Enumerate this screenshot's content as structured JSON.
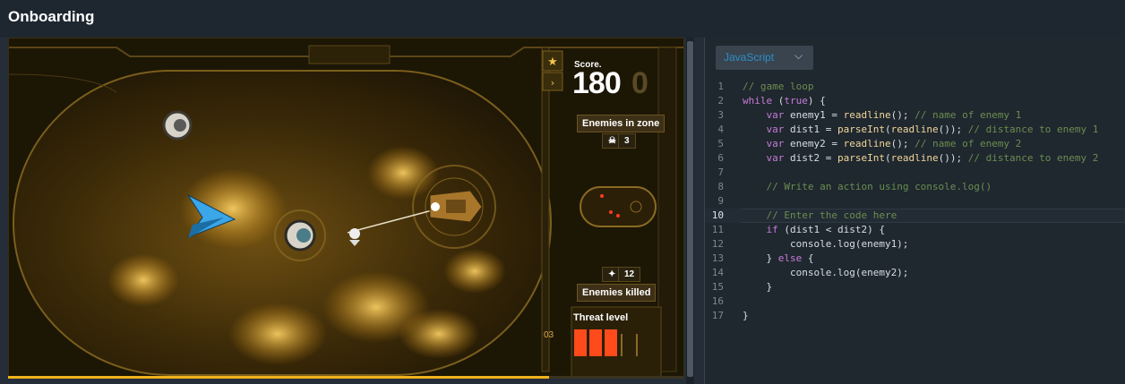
{
  "app": {
    "title": "Onboarding"
  },
  "game": {
    "score_label": "Score.",
    "score_value": "180",
    "score_ghost_digit": "0",
    "enemies_in_zone_label": "Enemies in zone",
    "enemies_in_zone_count": "3",
    "enemies_killed_label": "Enemies killed",
    "enemies_killed_count": "12",
    "threat_level_label": "Threat level",
    "threat_level_value": "03",
    "progress_fraction": 0.8,
    "accent_color": "#f2b21c",
    "icons": [
      "star-icon",
      "arrow-icon",
      "skull-icon",
      "kills-icon",
      "radar-icon"
    ]
  },
  "editor": {
    "language": "JavaScript",
    "active_line": 10,
    "lines": [
      {
        "n": "1",
        "code": "// game loop"
      },
      {
        "n": "2",
        "code": "while (true) {"
      },
      {
        "n": "3",
        "code": "    var enemy1 = readline(); // name of enemy 1"
      },
      {
        "n": "4",
        "code": "    var dist1 = parseInt(readline()); // distance to enemy 1"
      },
      {
        "n": "5",
        "code": "    var enemy2 = readline(); // name of enemy 2"
      },
      {
        "n": "6",
        "code": "    var dist2 = parseInt(readline()); // distance to enemy 2"
      },
      {
        "n": "7",
        "code": ""
      },
      {
        "n": "8",
        "code": "    // Write an action using console.log()"
      },
      {
        "n": "9",
        "code": ""
      },
      {
        "n": "10",
        "code": "    // Enter the code here"
      },
      {
        "n": "11",
        "code": "    if (dist1 < dist2) {"
      },
      {
        "n": "12",
        "code": "        console.log(enemy1);"
      },
      {
        "n": "13",
        "code": "    } else {"
      },
      {
        "n": "14",
        "code": "        console.log(enemy2);"
      },
      {
        "n": "15",
        "code": "    }"
      },
      {
        "n": "16",
        "code": ""
      },
      {
        "n": "17",
        "code": "}"
      }
    ]
  }
}
